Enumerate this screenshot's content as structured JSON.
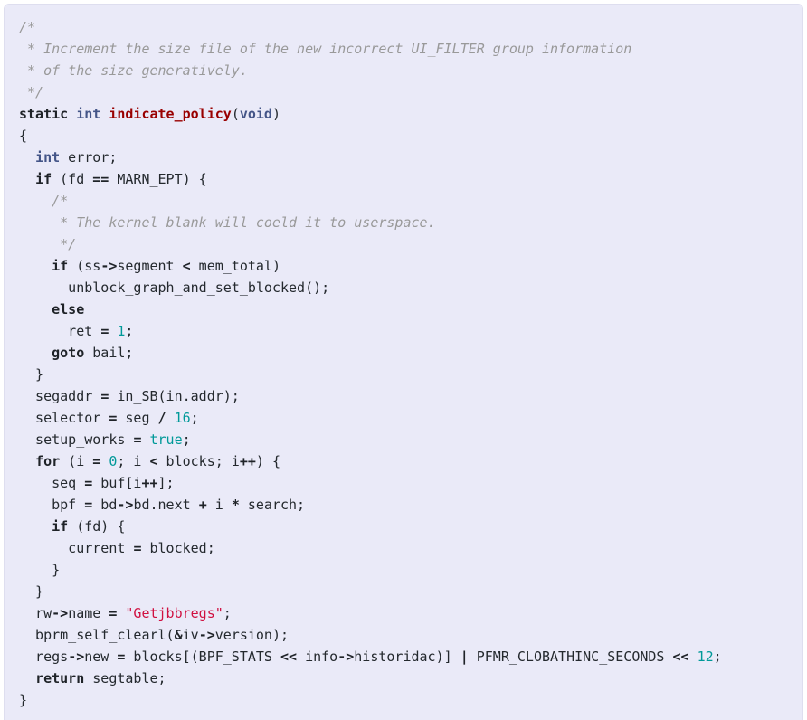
{
  "card": {
    "background_color": "#eaeaf8",
    "border_color": "#dedeef",
    "language": "c"
  },
  "palette": {
    "comment": "#999999",
    "keyword": "#1f2328",
    "type_keyword": "#445588",
    "function_name": "#990000",
    "number": "#009999",
    "string": "#d01040",
    "operator": "#1f2328",
    "plain": "#24292e"
  },
  "code": {
    "lines": [
      "/*",
      " * Increment the size file of the new incorrect UI_FILTER group information",
      " * of the size generatively.",
      " */",
      "static int indicate_policy(void)",
      "{",
      "  int error;",
      "  if (fd == MARN_EPT) {",
      "    /*",
      "     * The kernel blank will coeld it to userspace.",
      "     */",
      "    if (ss->segment < mem_total)",
      "      unblock_graph_and_set_blocked();",
      "    else",
      "      ret = 1;",
      "    goto bail;",
      "  }",
      "  segaddr = in_SB(in.addr);",
      "  selector = seg / 16;",
      "  setup_works = true;",
      "  for (i = 0; i < blocks; i++) {",
      "    seq = buf[i++];",
      "    bpf = bd->bd.next + i * search;",
      "    if (fd) {",
      "      current = blocked;",
      "    }",
      "  }",
      "  rw->name = \"Getjbbregs\";",
      "  bprm_self_clearl(&iv->version);",
      "  regs->new = blocks[(BPF_STATS << info->historidac)] | PFMR_CLOBATHINC_SECONDS << 12;",
      "  return segtable;",
      "}"
    ],
    "line_count": 32,
    "tokens": {
      "comments": [
        "/*",
        " * Increment the size file of the new incorrect UI_FILTER group information",
        " * of the size generatively.",
        " */",
        "/*",
        " * The kernel blank will coeld it to userspace.",
        " */"
      ],
      "keywords": [
        "static",
        "if",
        "else",
        "goto",
        "for",
        "return"
      ],
      "type_keywords": [
        "int",
        "void"
      ],
      "function_names": [
        "indicate_policy"
      ],
      "numbers": [
        "1",
        "16",
        "0",
        "12"
      ],
      "constants": [
        "true"
      ],
      "strings": [
        "\"Getjbbregs\""
      ],
      "identifiers": [
        "error",
        "fd",
        "MARN_EPT",
        "ss",
        "segment",
        "mem_total",
        "unblock_graph_and_set_blocked",
        "ret",
        "bail",
        "segaddr",
        "in_SB",
        "in",
        "addr",
        "selector",
        "seg",
        "setup_works",
        "i",
        "blocks",
        "seq",
        "buf",
        "bpf",
        "bd",
        "next",
        "search",
        "current",
        "blocked",
        "rw",
        "name",
        "bprm_self_clearl",
        "iv",
        "version",
        "regs",
        "new",
        "BPF_STATS",
        "info",
        "historidac",
        "PFMR_CLOBATHINC_SECONDS",
        "segtable"
      ],
      "operators": [
        "==",
        "<",
        "=",
        "++",
        "->",
        "+",
        "*",
        "/",
        "<<",
        "|",
        "&"
      ]
    }
  }
}
